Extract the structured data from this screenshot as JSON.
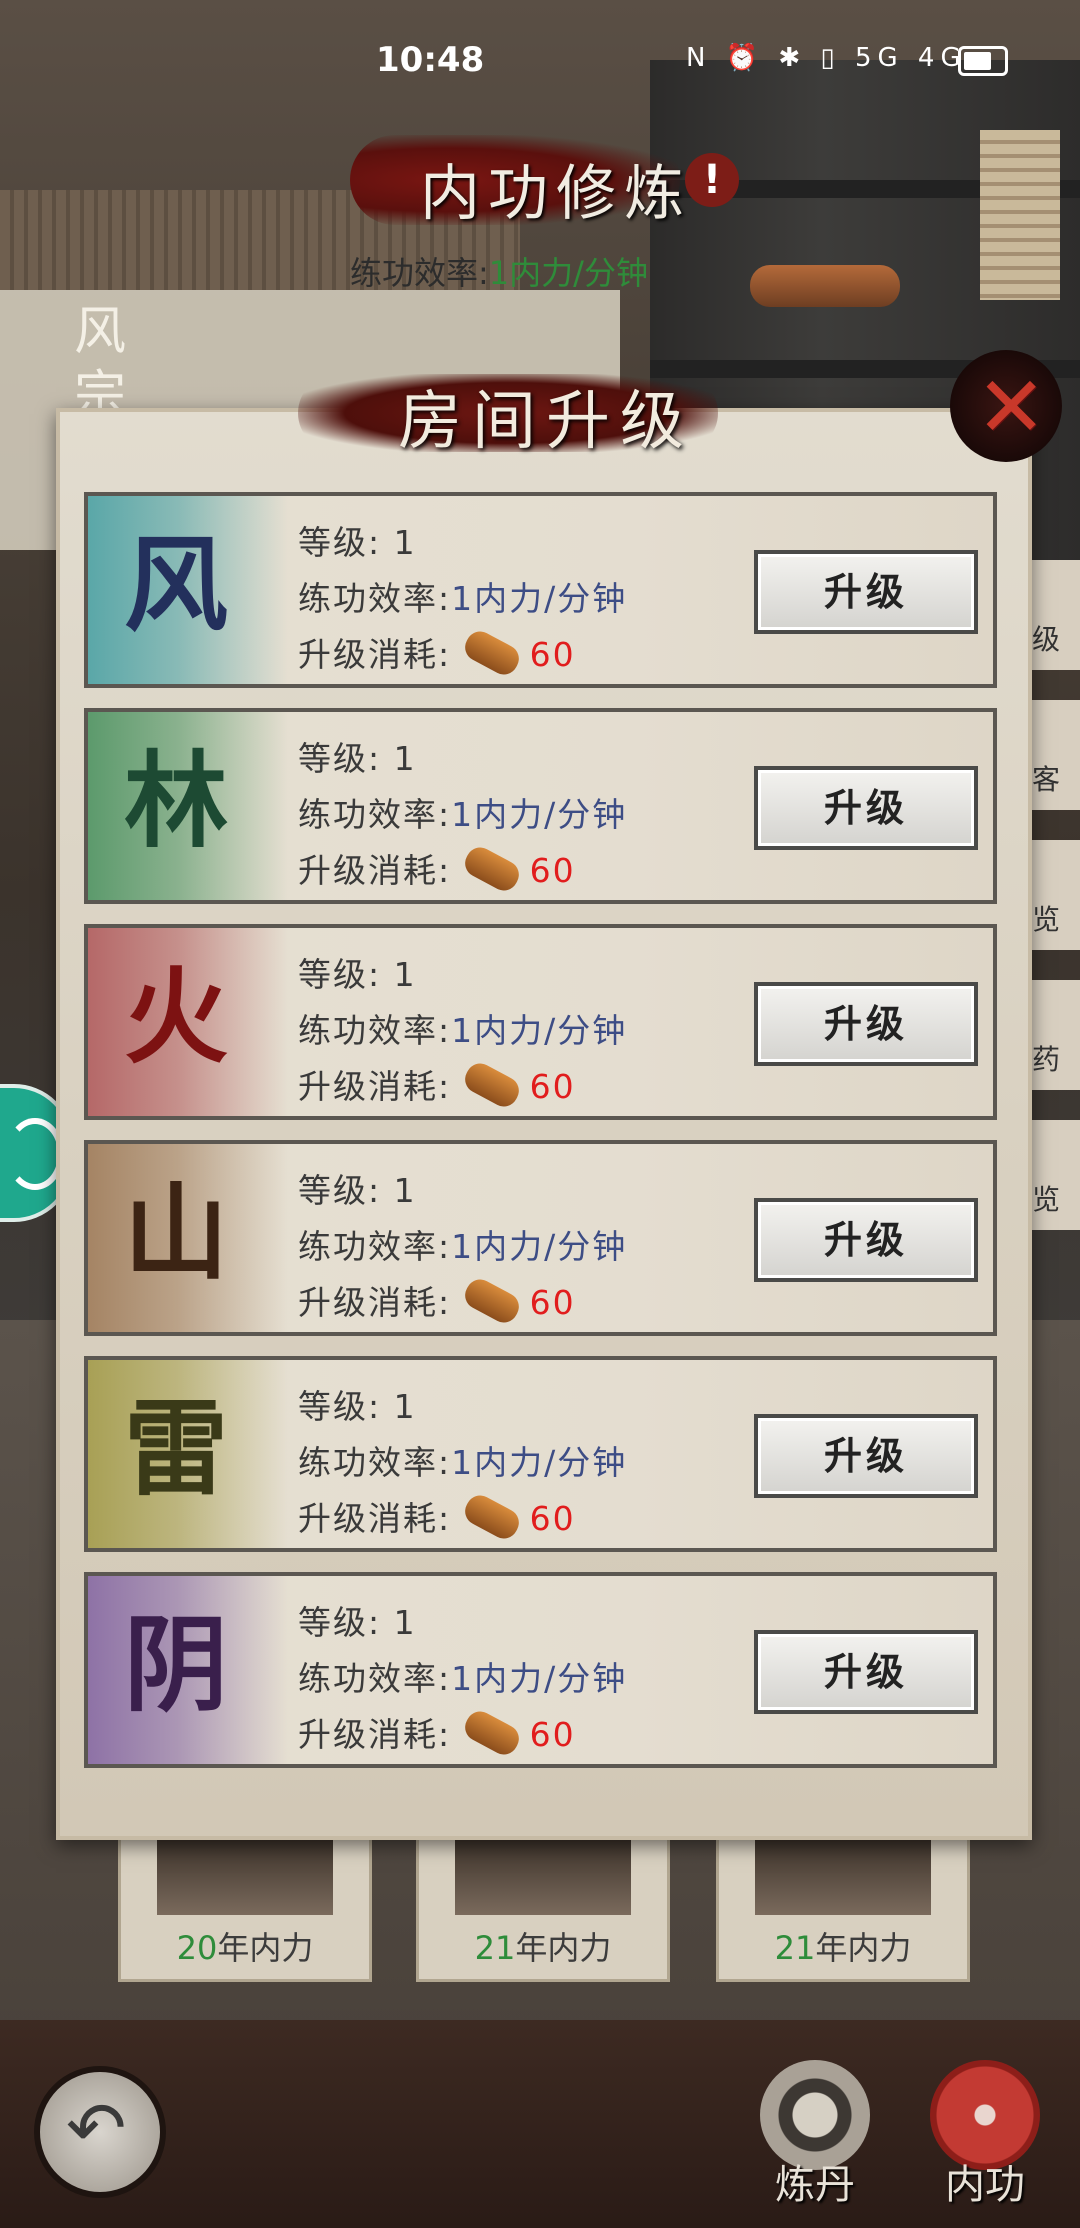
{
  "status_bar": {
    "time": "10:48",
    "icons": "N ⏰ ✱ ▯ 5G 4G",
    "battery_level": 0.7
  },
  "screen": {
    "title": "内功修炼",
    "alert": "!",
    "rate_label": "练功效率:",
    "rate_value": "1内力/分钟",
    "side_label": "风宗"
  },
  "side_tabs": [
    "级",
    "客",
    "览",
    "药",
    "览"
  ],
  "dialog": {
    "title": "房间升级",
    "close_icon": "close-x-icon",
    "rooms": [
      {
        "glyph": "风",
        "glyph_color": "#23305c",
        "tint": "#5aa7a8",
        "level_label": "等级:",
        "level": "1",
        "eff_label": "练功效率:",
        "eff_value": "1内力/分钟",
        "cost_label": "升级消耗:",
        "cost": "60",
        "button": "升级"
      },
      {
        "glyph": "林",
        "glyph_color": "#1d4a33",
        "tint": "#5c9a6c",
        "level_label": "等级:",
        "level": "1",
        "eff_label": "练功效率:",
        "eff_value": "1内力/分钟",
        "cost_label": "升级消耗:",
        "cost": "60",
        "button": "升级"
      },
      {
        "glyph": "火",
        "glyph_color": "#7d1212",
        "tint": "#b56868",
        "level_label": "等级:",
        "level": "1",
        "eff_label": "练功效率:",
        "eff_value": "1内力/分钟",
        "cost_label": "升级消耗:",
        "cost": "60",
        "button": "升级"
      },
      {
        "glyph": "山",
        "glyph_color": "#3c2414",
        "tint": "#a58464",
        "level_label": "等级:",
        "level": "1",
        "eff_label": "练功效率:",
        "eff_value": "1内力/分钟",
        "cost_label": "升级消耗:",
        "cost": "60",
        "button": "升级"
      },
      {
        "glyph": "雷",
        "glyph_color": "#3a3a18",
        "tint": "#a8a055",
        "level_label": "等级:",
        "level": "1",
        "eff_label": "练功效率:",
        "eff_value": "1内力/分钟",
        "cost_label": "升级消耗:",
        "cost": "60",
        "button": "升级"
      },
      {
        "glyph": "阴",
        "glyph_color": "#3a1f4c",
        "tint": "#8e72a6",
        "level_label": "等级:",
        "level": "1",
        "eff_label": "练功效率:",
        "eff_value": "1内力/分钟",
        "cost_label": "升级消耗:",
        "cost": "60",
        "button": "升级"
      }
    ]
  },
  "heroes": [
    {
      "years": "20",
      "suffix": "年内力"
    },
    {
      "years": "21",
      "suffix": "年内力"
    },
    {
      "years": "21",
      "suffix": "年内力"
    }
  ],
  "bottom_nav": {
    "back_icon": "back-arrow-icon",
    "alchemy": "炼丹",
    "neigong": "内功"
  }
}
